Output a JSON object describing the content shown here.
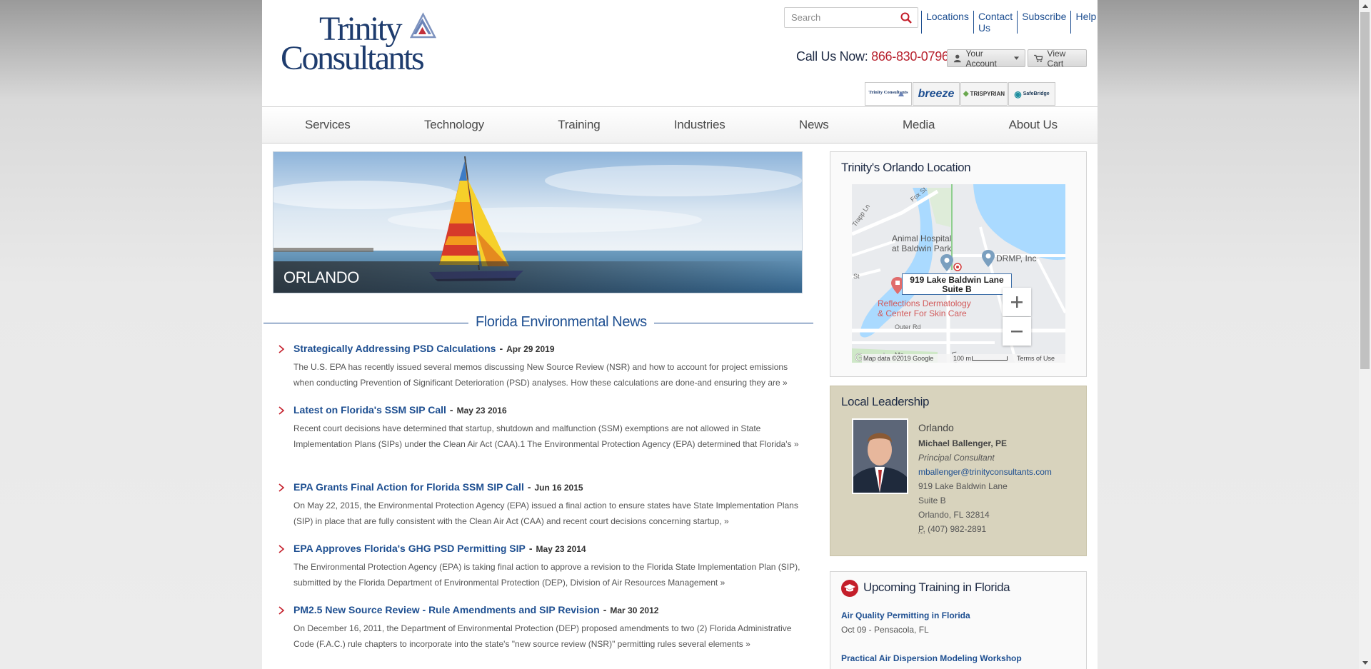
{
  "header": {
    "logo_line1": "Trinity",
    "logo_line2": "Consultants",
    "search_placeholder": "Search",
    "top_links": [
      "Locations",
      "Contact Us",
      "Subscribe",
      "Help"
    ],
    "call_label": "Call Us Now:",
    "call_number": "866-830-0796",
    "account_button": "Your Account",
    "cart_button": "View Cart",
    "brands": [
      "Trinity Consultants",
      "breeze",
      "TRISPYRIAN",
      "SafeBridge"
    ]
  },
  "nav": [
    "Services",
    "Technology",
    "Training",
    "Industries",
    "News",
    "Media",
    "About Us"
  ],
  "hero": {
    "label": "ORLANDO"
  },
  "news": {
    "heading": "Florida Environmental News",
    "items": [
      {
        "title": "Strategically Addressing PSD Calculations",
        "date": "Apr 29 2019",
        "body": "The U.S. EPA has recently issued several memos discussing New Source Review (NSR) and how to account for project emissions when conducting Prevention of Significant Deterioration (PSD) analyses. How these calculations are done-and ensuring they are »"
      },
      {
        "title": "Latest on Florida's SSM SIP Call",
        "date": "May 23 2016",
        "body": "Recent court decisions have determined that startup, shutdown and malfunction (SSM) exemptions are not allowed in State Implementation Plans (SIPs) under the Clean Air Act (CAA).1  The Environmental Protection Agency (EPA) determined that Florida's »"
      },
      {
        "title": "EPA Grants Final Action for Florida SSM SIP Call",
        "date": "Jun 16 2015",
        "body": "On May 22, 2015, the Environmental Protection Agency (EPA) issued a final action to ensure states have State Implementation Plans (SIP) in place that are fully consistent with the Clean Air Act (CAA) and recent court decisions concerning startup, »"
      },
      {
        "title": "EPA Approves Florida's GHG PSD Permitting SIP",
        "date": "May 23 2014",
        "body": "The Environmental Protection Agency (EPA) is taking final action to approve a revision to the Florida State Implementation Plan (SIP), submitted by the Florida Department of Environmental Protection (DEP), Division of Air Resources Management »"
      },
      {
        "title": "PM2.5 New Source Review - Rule Amendments and SIP Revision",
        "date": "Mar 30 2012",
        "body": "On December 16, 2011, the Department of Environmental Protection (DEP) proposed amendments to two (2) Florida Administrative Code (F.A.C.) rule chapters to incorporate into the state's \"new source review (NSR)\" permitting rules several elements »"
      }
    ]
  },
  "location": {
    "title": "Trinity's Orlando Location",
    "map": {
      "fox": "Fox St",
      "trapp": "Trapp Ln",
      "animal1": "Animal Hospital",
      "animal2": "at Baldwin Park",
      "drmp": "DRMP, Inc",
      "callout1": "919 Lake Baldwin Lane",
      "callout2": "Suite B",
      "refl1": "Reflections Dermatology",
      "refl2": "& Center For Skin Care",
      "outer": "Outer Rd",
      "lake": "Lake",
      "st": "St",
      "ma": "Ma",
      "google": "Google",
      "attribution": "Map data ©2019 Google",
      "scale": "100 m",
      "terms": "Terms of Use"
    }
  },
  "leadership": {
    "title": "Local Leadership",
    "city": "Orlando",
    "name": "Michael Ballenger, PE",
    "role": "Principal Consultant",
    "email": "mballenger@trinityconsultants.com",
    "addr1": "919 Lake Baldwin Lane",
    "addr2": "Suite B",
    "addr3": "Orlando, FL 32814",
    "phone_label": "P.",
    "phone": "(407) 982-2891"
  },
  "training": {
    "title": "Upcoming Training in Florida",
    "items": [
      {
        "name": "Air Quality Permitting in Florida",
        "detail": "Oct 09 - Pensacola, FL"
      },
      {
        "name": "Practical Air Dispersion Modeling Workshop",
        "detail": ""
      }
    ]
  },
  "colors": {
    "brand_blue": "#1e4f91",
    "accent_red": "#b8232f",
    "leadership_bg": "#d8d3bd"
  }
}
